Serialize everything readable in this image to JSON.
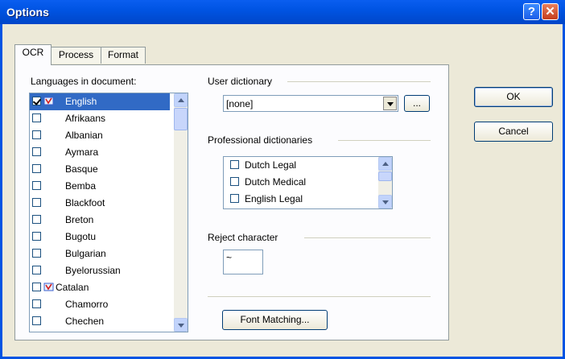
{
  "window": {
    "title": "Options"
  },
  "tabs": [
    "OCR",
    "Process",
    "Format"
  ],
  "languages": {
    "label": "Languages in document:",
    "items": [
      {
        "name": "English",
        "checked": true,
        "selected": true,
        "flag": true
      },
      {
        "name": "Afrikaans",
        "checked": false,
        "flag": false
      },
      {
        "name": "Albanian",
        "checked": false,
        "flag": false
      },
      {
        "name": "Aymara",
        "checked": false,
        "flag": false
      },
      {
        "name": "Basque",
        "checked": false,
        "flag": false
      },
      {
        "name": "Bemba",
        "checked": false,
        "flag": false
      },
      {
        "name": "Blackfoot",
        "checked": false,
        "flag": false
      },
      {
        "name": "Breton",
        "checked": false,
        "flag": false
      },
      {
        "name": "Bugotu",
        "checked": false,
        "flag": false
      },
      {
        "name": "Bulgarian",
        "checked": false,
        "flag": false
      },
      {
        "name": "Byelorussian",
        "checked": false,
        "flag": false
      },
      {
        "name": "Catalan",
        "checked": false,
        "flag": true
      },
      {
        "name": "Chamorro",
        "checked": false,
        "flag": false
      },
      {
        "name": "Chechen",
        "checked": false,
        "flag": false
      }
    ]
  },
  "user_dictionary": {
    "label": "User dictionary",
    "value": "[none]",
    "browse_label": "..."
  },
  "professional_dictionaries": {
    "label": "Professional dictionaries",
    "items": [
      "Dutch Legal",
      "Dutch Medical",
      "English Legal"
    ]
  },
  "reject_character": {
    "label": "Reject character",
    "value": "~"
  },
  "buttons": {
    "font_matching": "Font Matching...",
    "ok": "OK",
    "cancel": "Cancel"
  },
  "colors": {
    "title_bar": "#0054e3",
    "selection": "#316ac5",
    "dialog_bg": "#ece9d8"
  }
}
